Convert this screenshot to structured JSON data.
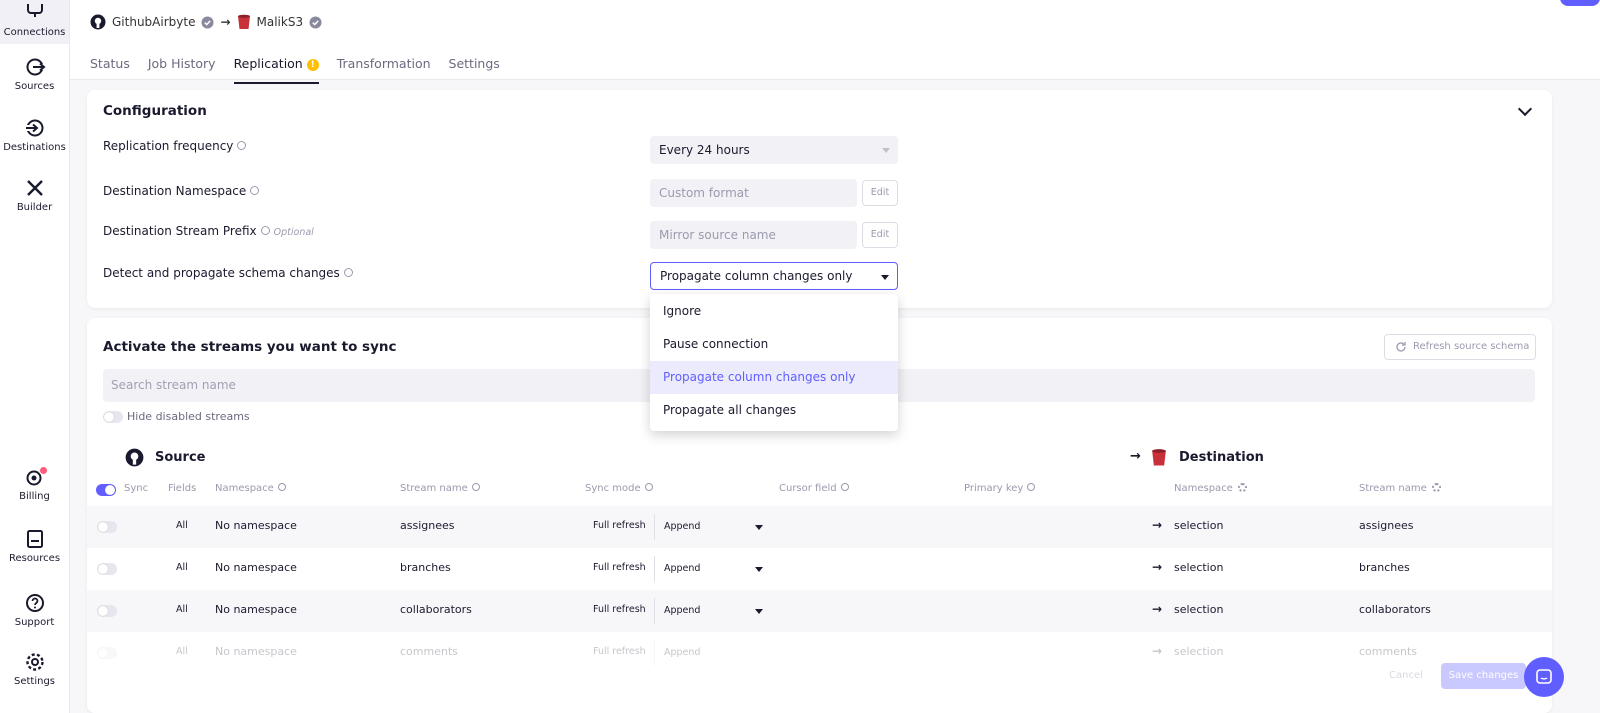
{
  "sidebar": {
    "items": [
      {
        "label": "Connections",
        "icon": "connections-icon",
        "active": true
      },
      {
        "label": "Sources",
        "icon": "sources-icon"
      },
      {
        "label": "Destinations",
        "icon": "destinations-icon"
      },
      {
        "label": "Builder",
        "icon": "builder-icon"
      },
      {
        "label": "Billing",
        "icon": "billing-icon"
      },
      {
        "label": "Resources",
        "icon": "resources-icon"
      },
      {
        "label": "Support",
        "icon": "support-icon"
      },
      {
        "label": "Settings",
        "icon": "settings-icon"
      }
    ]
  },
  "header": {
    "source_name": "GithubAirbyte",
    "destination_name": "MalikS3",
    "tabs": [
      {
        "label": "Status"
      },
      {
        "label": "Job History"
      },
      {
        "label": "Replication",
        "active": true,
        "warning": "!"
      },
      {
        "label": "Transformation"
      },
      {
        "label": "Settings"
      }
    ]
  },
  "configuration": {
    "title": "Configuration",
    "replication_frequency": {
      "label": "Replication frequency",
      "value": "Every 24 hours"
    },
    "destination_namespace": {
      "label": "Destination Namespace",
      "value": "Custom format",
      "edit": "Edit"
    },
    "stream_prefix": {
      "label": "Destination Stream Prefix",
      "optional": "Optional",
      "placeholder": "Mirror source name",
      "edit": "Edit"
    },
    "schema_changes": {
      "label": "Detect and propagate schema changes",
      "value": "Propagate column changes only"
    }
  },
  "schema_menu": {
    "options": [
      "Ignore",
      "Pause connection",
      "Propagate column changes only",
      "Propagate all changes"
    ],
    "selected_index": 2
  },
  "streams": {
    "title": "Activate the streams you want to sync",
    "refresh_label": "Refresh source schema",
    "search_placeholder": "Search stream name",
    "hide_disabled_label": "Hide disabled streams",
    "source_heading": "Source",
    "destination_heading": "Destination",
    "columns": {
      "sync": "Sync",
      "fields": "Fields",
      "namespace": "Namespace",
      "stream_name": "Stream name",
      "sync_mode": "Sync mode",
      "cursor_field": "Cursor field",
      "primary_key": "Primary key",
      "dest_namespace": "Namespace",
      "dest_stream_name": "Stream name"
    },
    "rows": [
      {
        "fields": "All",
        "namespace": "No namespace",
        "stream": "assignees",
        "mode": "Full refresh",
        "dest_mode": "Append",
        "dest_namespace": "selection",
        "dest_stream": "assignees"
      },
      {
        "fields": "All",
        "namespace": "No namespace",
        "stream": "branches",
        "mode": "Full refresh",
        "dest_mode": "Append",
        "dest_namespace": "selection",
        "dest_stream": "branches"
      },
      {
        "fields": "All",
        "namespace": "No namespace",
        "stream": "collaborators",
        "mode": "Full refresh",
        "dest_mode": "Append",
        "dest_namespace": "selection",
        "dest_stream": "collaborators"
      },
      {
        "fields": "All",
        "namespace": "No namespace",
        "stream": "comments",
        "mode": "Full refresh",
        "dest_mode": "Append",
        "dest_namespace": "selection",
        "dest_stream": "comments"
      }
    ]
  },
  "footer": {
    "cancel": "Cancel",
    "save": "Save changes"
  },
  "colors": {
    "accent": "#615eff",
    "warning": "#ffbf00",
    "bucket": "#c8303a"
  }
}
